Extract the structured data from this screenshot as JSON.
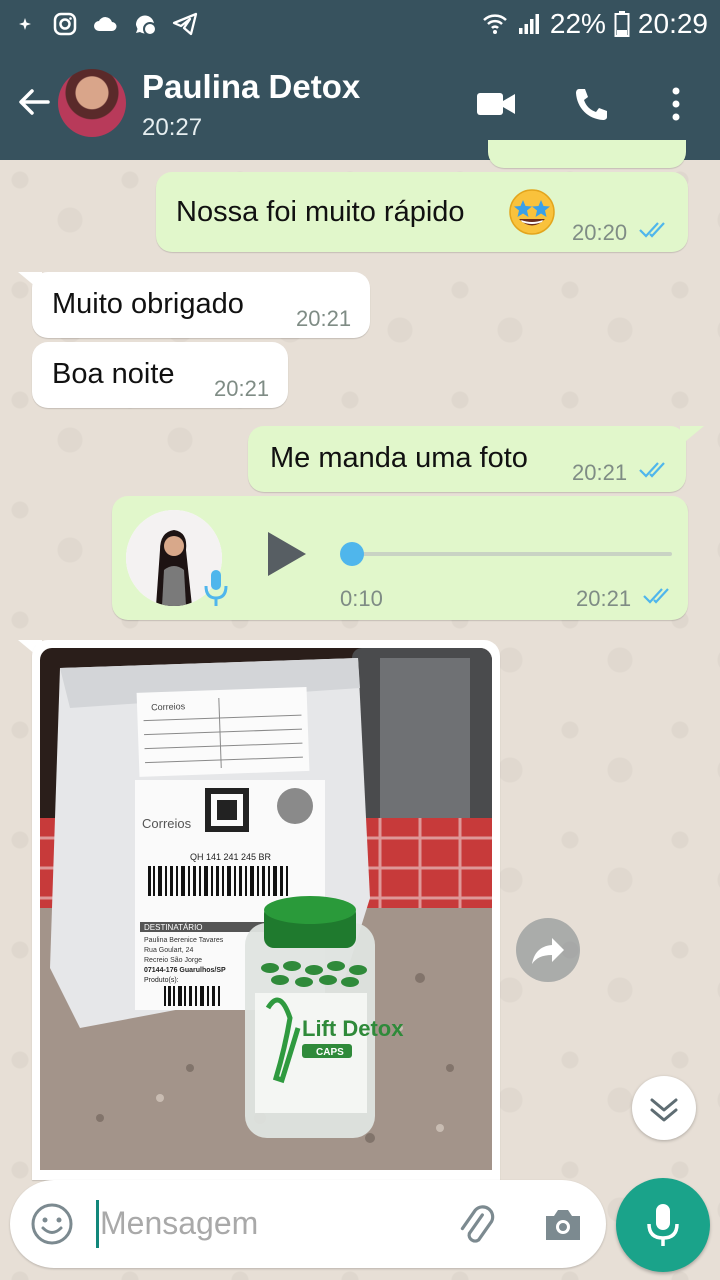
{
  "status_bar": {
    "battery": "22%",
    "time": "20:29",
    "icons": [
      "sparkle-icon",
      "instagram-icon",
      "cloud-icon",
      "whatsapp-business-icon",
      "telegram-icon",
      "wifi-icon",
      "signal-icon",
      "battery-icon"
    ]
  },
  "header": {
    "contact_name": "Paulina Detox",
    "last_seen": "20:27",
    "icons": [
      "back-arrow-icon",
      "video-call-icon",
      "phone-icon",
      "more-vert-icon"
    ]
  },
  "messages": [
    {
      "direction": "out",
      "text": "Nossa foi muito rápido",
      "emoji": "star-struck-emoji",
      "time": "20:20",
      "status": "read"
    },
    {
      "direction": "in",
      "text": "Muito obrigado",
      "time": "20:21"
    },
    {
      "direction": "in",
      "text": "Boa noite",
      "time": "20:21"
    },
    {
      "direction": "out",
      "text": "Me manda uma foto",
      "time": "20:21",
      "status": "read"
    },
    {
      "direction": "out",
      "type": "voice",
      "duration": "0:10",
      "time": "20:21",
      "status": "read",
      "progress": 0
    },
    {
      "direction": "in",
      "type": "image",
      "image_text": {
        "logo": "Correios",
        "logo_small": "Correios",
        "tracking": "QH 141 241 245 BR",
        "recipient_header": "DESTINATÁRIO",
        "recipient_name": "Paulina Berenice Tavares",
        "address_line1": "Rua Goulart, 24",
        "address_line2": "Recreio São Jorge",
        "cep_city": "07144-176  Guarulhos/SP",
        "product_label": "Produto(s):",
        "product_bottle": "Lift Detox",
        "product_bottle_sub": "CAPS"
      }
    }
  ],
  "input": {
    "placeholder": "Mensagem",
    "icons": [
      "emoji-icon",
      "attach-icon",
      "camera-icon",
      "mic-icon"
    ]
  },
  "colors": {
    "header": "#37525e",
    "outgoing_bubble": "#e1f7cb",
    "incoming_bubble": "#ffffff",
    "read_ticks": "#4fb6ec",
    "accent": "#1aa38a"
  }
}
